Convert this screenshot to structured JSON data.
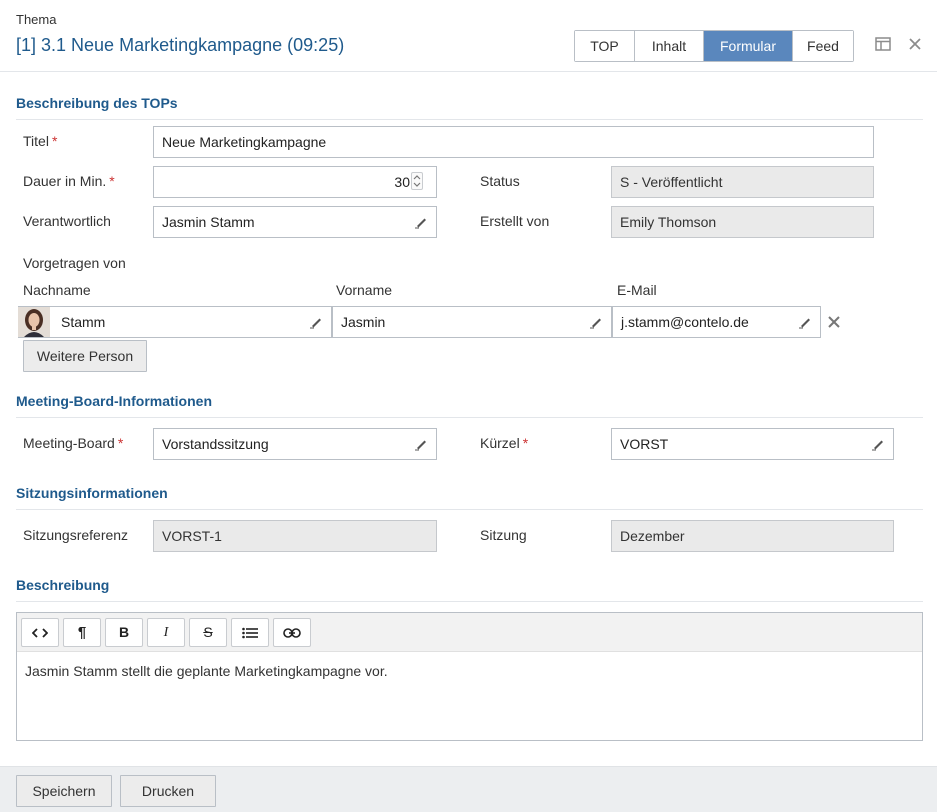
{
  "header": {
    "kicker": "Thema",
    "title": "[1] 3.1 Neue Marketingkampagne (09:25)",
    "tabs": [
      {
        "label": "TOP"
      },
      {
        "label": "Inhalt"
      },
      {
        "label": "Formular",
        "active": true
      },
      {
        "label": "Feed"
      }
    ],
    "icons": [
      "window-icon",
      "close-icon"
    ]
  },
  "section_top": {
    "heading": "Beschreibung des TOPs",
    "title_label": "Titel",
    "title_value": "Neue Marketingkampagne",
    "duration_label": "Dauer in Min.",
    "duration_value": "30",
    "status_label": "Status",
    "status_value": "S - Veröffentlicht",
    "responsible_label": "Verantwortlich",
    "responsible_value": "Jasmin Stamm",
    "created_by_label": "Erstellt von",
    "created_by_value": "Emily Thomson",
    "presented_by_label": "Vorgetragen von",
    "columns": {
      "lastname": "Nachname",
      "firstname": "Vorname",
      "email": "E-Mail"
    },
    "presenters": [
      {
        "lastname": "Stamm",
        "firstname": "Jasmin",
        "email": "j.stamm@contelo.de"
      }
    ],
    "add_person_label": "Weitere Person"
  },
  "section_board": {
    "heading": "Meeting-Board-Informationen",
    "board_label": "Meeting-Board",
    "board_value": "Vorstandssitzung",
    "short_label": "Kürzel",
    "short_value": "VORST"
  },
  "section_session": {
    "heading": "Sitzungsinformationen",
    "ref_label": "Sitzungsreferenz",
    "ref_value": "VORST-1",
    "session_label": "Sitzung",
    "session_value": "Dezember"
  },
  "section_desc": {
    "heading": "Beschreibung",
    "toolbar": [
      "code-icon",
      "paragraph-icon",
      "bold-icon",
      "italic-icon",
      "strikethrough-icon",
      "bullet-list-icon",
      "link-icon"
    ],
    "text": "Jasmin Stamm stellt die geplante Marketingkampagne vor."
  },
  "footer": {
    "save_label": "Speichern",
    "print_label": "Drucken"
  },
  "colors": {
    "accent": "#1f5a8c",
    "active_tab": "#5a87bd",
    "required": "#cc3333"
  }
}
